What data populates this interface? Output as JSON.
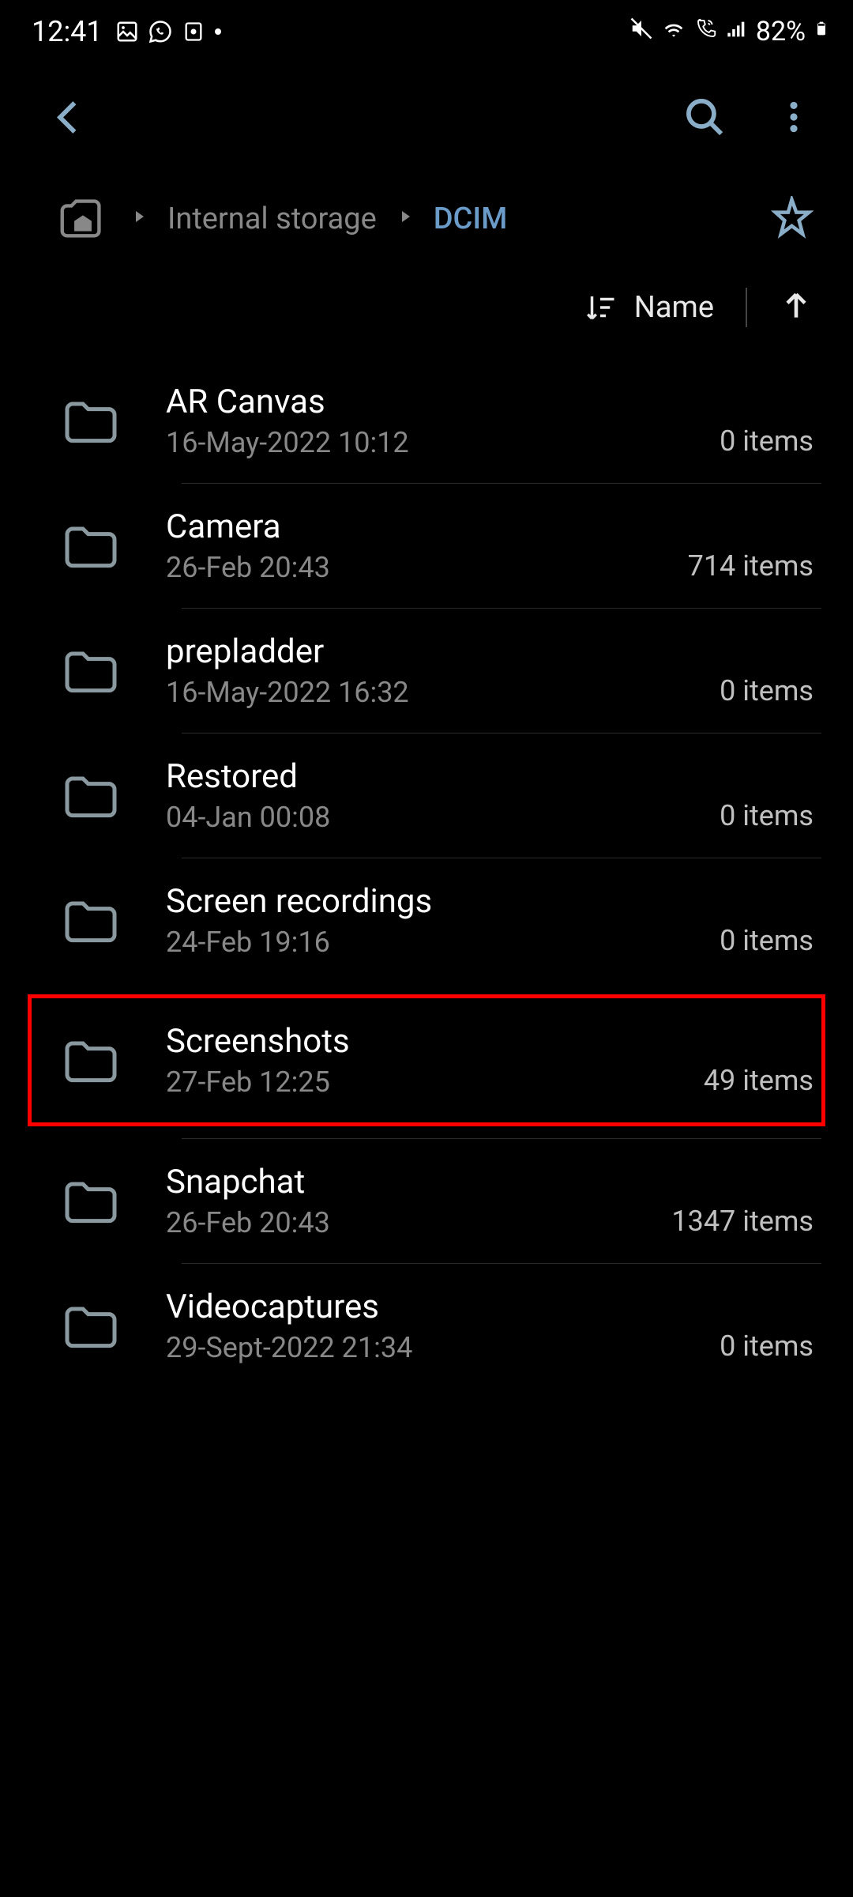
{
  "statusBar": {
    "time": "12:41",
    "battery": "82%"
  },
  "breadcrumb": {
    "parent": "Internal storage",
    "current": "DCIM"
  },
  "sort": {
    "label": "Name"
  },
  "folders": [
    {
      "name": "AR Canvas",
      "date": "16-May-2022 10:12",
      "count": "0 items",
      "highlighted": false
    },
    {
      "name": "Camera",
      "date": "26-Feb 20:43",
      "count": "714 items",
      "highlighted": false
    },
    {
      "name": "prepladder",
      "date": "16-May-2022 16:32",
      "count": "0 items",
      "highlighted": false
    },
    {
      "name": "Restored",
      "date": "04-Jan 00:08",
      "count": "0 items",
      "highlighted": false
    },
    {
      "name": "Screen recordings",
      "date": "24-Feb 19:16",
      "count": "0 items",
      "highlighted": false
    },
    {
      "name": "Screenshots",
      "date": "27-Feb 12:25",
      "count": "49 items",
      "highlighted": true
    },
    {
      "name": "Snapchat",
      "date": "26-Feb 20:43",
      "count": "1347 items",
      "highlighted": false
    },
    {
      "name": "Videocaptures",
      "date": "29-Sept-2022 21:34",
      "count": "0 items",
      "highlighted": false
    }
  ]
}
